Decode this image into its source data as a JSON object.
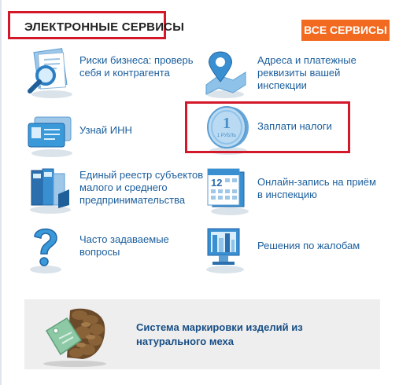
{
  "header": {
    "title": "ЭЛЕКТРОННЫЕ СЕРВИСЫ",
    "all_services_button": "ВСЕ СЕРВИСЫ"
  },
  "colors": {
    "highlight_border": "#d3182a",
    "button_bg": "#f26a1f",
    "link_text": "#1b5e9c",
    "icon_blue": "#3a9ad9"
  },
  "services": [
    {
      "icon": "magnifier-document-icon",
      "label": "Риски бизнеса: проверь себя и контрагента"
    },
    {
      "icon": "map-pin-icon",
      "label": "Адреса и платежные реквизиты вашей инспекции"
    },
    {
      "icon": "id-cards-icon",
      "label": "Узнай ИНН"
    },
    {
      "icon": "ruble-coin-icon",
      "label": "Заплати налоги"
    },
    {
      "icon": "registry-folders-icon",
      "label": "Единый реестр субъектов малого и среднего предпринимательства"
    },
    {
      "icon": "calendar-icon",
      "label": "Онлайн-запись на приём в инспекцию"
    },
    {
      "icon": "question-mark-icon",
      "label": "Часто задаваемые вопросы"
    },
    {
      "icon": "complaint-monitor-icon",
      "label": "Решения по жалобам"
    }
  ],
  "coin_text": "1 РУБЛЬ",
  "calendar_day": "12",
  "banner": {
    "icon": "fur-tag-icon",
    "text": "Система маркировки изделий из натурального меха"
  }
}
